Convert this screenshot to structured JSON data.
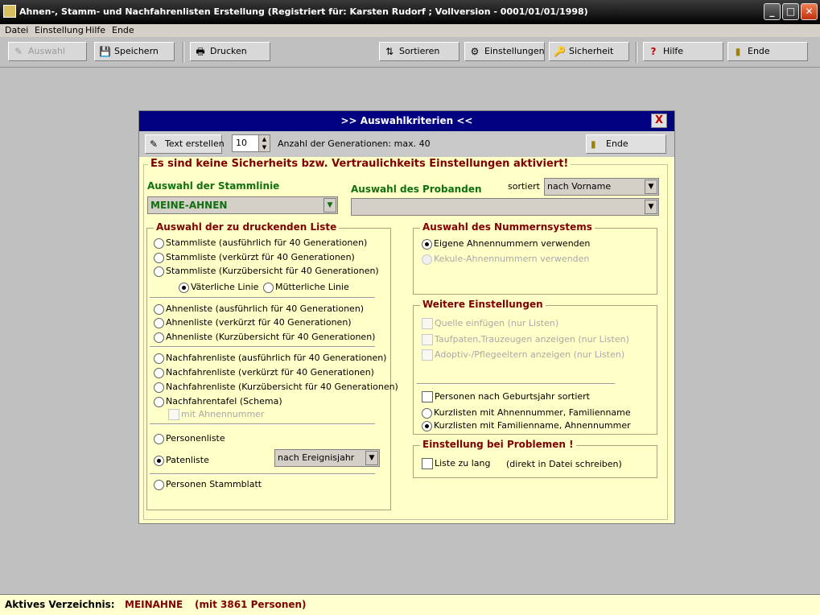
{
  "window": {
    "title": "Ahnen-, Stamm- und Nachfahrenlisten Erstellung  (Registriert für: Karsten Rudorf ; Vollversion - 0001/01/01/1998)",
    "minimize": "_",
    "maximize": "□",
    "close": "✕"
  },
  "menu": [
    "Datei",
    "Einstellung",
    "Hilfe",
    "Ende"
  ],
  "toolbar": {
    "auswahl": "Auswahl",
    "speichern": "Speichern",
    "drucken": "Drucken",
    "sortieren": "Sortieren",
    "einstellungen": "Einstellungen",
    "sicherheit": "Sicherheit",
    "hilfe": "Hilfe",
    "ende": "Ende"
  },
  "icons": {
    "auswahl": "✎",
    "speichern": "💾",
    "drucken": "🖶",
    "sortieren": "⇅",
    "einstellungen": "⚙",
    "sicherheit": "🔑",
    "hilfe": "?",
    "ende": "▮",
    "text": "✎",
    "dialog_ende": "▮"
  },
  "dialog": {
    "title": ">> Auswahlkriterien <<",
    "close": "X",
    "text_button": "Text erstellen",
    "generations_value": "10",
    "generations_label": "Anzahl der Generationen: max. 40",
    "ende_button": "Ende",
    "warning": "Es sind keine Sicherheits bzw. Vertraulichkeits Einstellungen aktiviert!",
    "stammlinie_label": "Auswahl der Stammlinie",
    "stammlinie_value": "MEINE-AHNEN",
    "proband_label": "Auswahl des Probanden",
    "proband_value": "",
    "sortiert_label": "sortiert",
    "sortiert_value": "nach Vorname",
    "liste": {
      "legend": "Auswahl der zu druckenden Liste",
      "stamm1": "Stammliste (ausführlich für 40 Generationen)",
      "stamm2": "Stammliste (verkürzt für 40 Generationen)",
      "stamm3": "Stammliste (Kurzübersicht für 40 Generationen)",
      "vaeterlich": "Väterliche Linie",
      "muetterlich": "Mütterliche Linie",
      "ahnen1": "Ahnenliste (ausführlich für 40 Generationen)",
      "ahnen2": "Ahnenliste (verkürzt für 40 Generationen)",
      "ahnen3": "Ahnenliste (Kurzübersicht für 40 Generationen)",
      "nach1": "Nachfahrenliste (ausführlich für 40 Generationen)",
      "nach2": "Nachfahrenliste (verkürzt für 40 Generationen)",
      "nach3": "Nachfahrenliste (Kurzübersicht für 40 Generationen)",
      "nachtafel": "Nachfahrentafel (Schema)",
      "mit_ahnennummer": "mit Ahnennummer",
      "personenliste": "Personenliste",
      "patenliste": "Patenliste",
      "paten_sort": "nach Ereignisjahr",
      "stammblatt": "Personen Stammblatt"
    },
    "nummern": {
      "legend": "Auswahl des Nummernsystems",
      "eigene": "Eigene Ahnennummern verwenden",
      "kekule": "Kekule-Ahnennummern verwenden"
    },
    "weitere": {
      "legend": "Weitere Einstellungen",
      "quelle": "Quelle einfügen (nur Listen)",
      "taufpaten": "Taufpaten,Trauzeugen anzeigen (nur Listen)",
      "adoptiv": "Adoptiv-/Pflegeeltern anzeigen (nur Listen)",
      "geburtsjahr": "Personen nach Geburtsjahr sortiert",
      "kurz1": "Kurzlisten mit Ahnennummer, Familienname",
      "kurz2": "Kurzlisten mit Familienname, Ahnennummer"
    },
    "probleme": {
      "legend": "Einstellung bei Problemen !",
      "liste_zu_lang": "Liste zu lang",
      "hint": "(direkt in Datei schreiben)"
    }
  },
  "status": {
    "label": "Aktives Verzeichnis:",
    "dir": "MEINAHNE",
    "count": "(mit 3861 Personen)"
  }
}
